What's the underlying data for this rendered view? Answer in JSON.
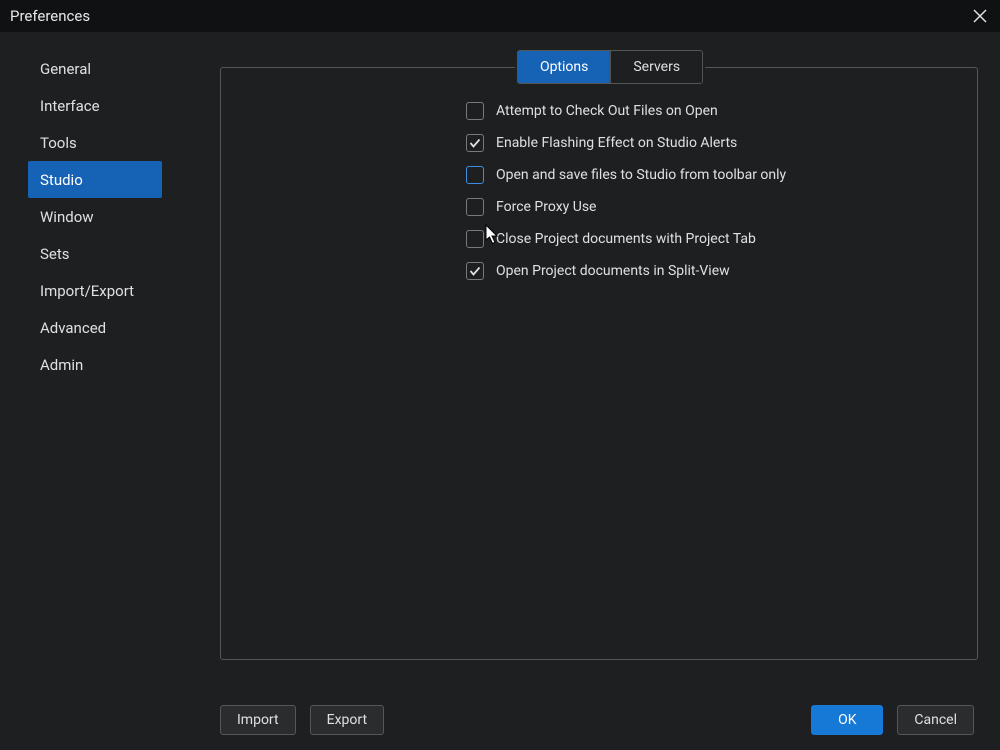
{
  "window": {
    "title": "Preferences"
  },
  "sidebar": {
    "items": [
      {
        "label": "General"
      },
      {
        "label": "Interface"
      },
      {
        "label": "Tools"
      },
      {
        "label": "Studio",
        "selected": true
      },
      {
        "label": "Window"
      },
      {
        "label": "Sets"
      },
      {
        "label": "Import/Export"
      },
      {
        "label": "Advanced"
      },
      {
        "label": "Admin"
      }
    ]
  },
  "tabs": {
    "options_label": "Options",
    "servers_label": "Servers",
    "active": "options"
  },
  "options": [
    {
      "label": "Attempt to Check Out Files on Open",
      "checked": false,
      "hover": false
    },
    {
      "label": "Enable Flashing Effect on Studio Alerts",
      "checked": true,
      "hover": false
    },
    {
      "label": "Open and save files to Studio from toolbar only",
      "checked": false,
      "hover": true
    },
    {
      "label": "Force Proxy Use",
      "checked": false,
      "hover": false
    },
    {
      "label": "Close Project documents with Project Tab",
      "checked": false,
      "hover": false
    },
    {
      "label": "Open Project documents in Split-View",
      "checked": true,
      "hover": false
    }
  ],
  "footer": {
    "import_label": "Import",
    "export_label": "Export",
    "ok_label": "OK",
    "cancel_label": "Cancel"
  },
  "colors": {
    "accent": "#1663b5",
    "accent_bright": "#1679d6",
    "bg": "#1d1f21",
    "titlebar": "#101112",
    "border": "#565656",
    "text": "#e0e0e0"
  }
}
